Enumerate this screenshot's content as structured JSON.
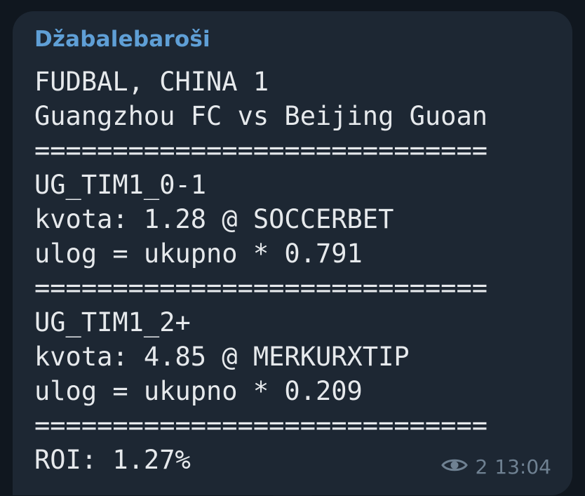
{
  "message": {
    "sender": "Džabalebaroši",
    "lines": [
      "FUDBAL, CHINA 1",
      "Guangzhou FC vs Beijing Guoan",
      "=============================",
      "UG_TIM1_0-1",
      "kvota: 1.28 @ SOCCERBET",
      "ulog = ukupno * 0.791",
      "=============================",
      "UG_TIM1_2+",
      "kvota: 4.85 @ MERKURXTIP",
      "ulog = ukupno * 0.209",
      "=============================",
      "ROI: 1.27%"
    ],
    "views": "2",
    "time": "13:04"
  },
  "colors": {
    "background": "#10171f",
    "bubble": "#1d2733",
    "sender": "#5f9fd6",
    "text": "#e6e9ec",
    "meta": "#6f8192"
  },
  "icons": {
    "views": "eye-icon"
  }
}
